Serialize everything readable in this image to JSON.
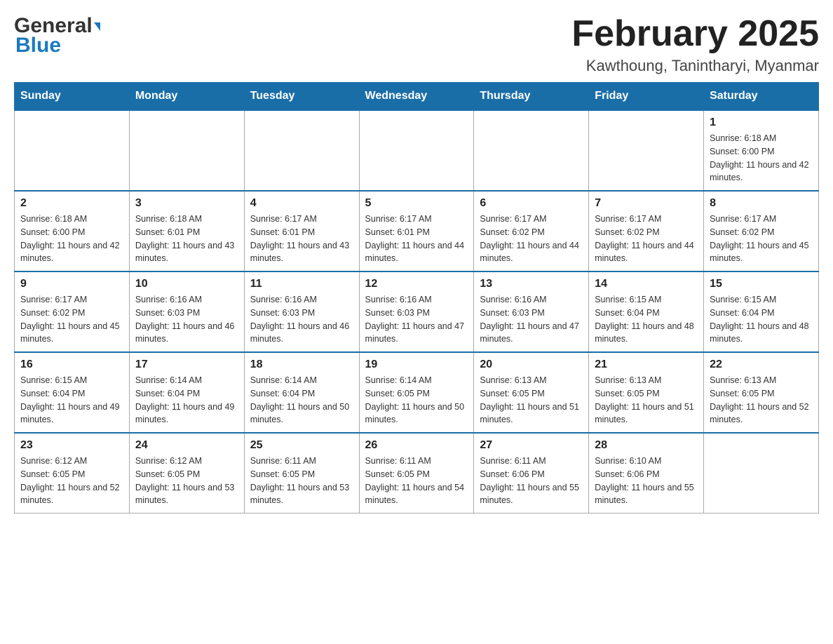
{
  "header": {
    "logo_general": "General",
    "logo_blue": "Blue",
    "month_title": "February 2025",
    "location": "Kawthoung, Tanintharyi, Myanmar"
  },
  "weekdays": [
    "Sunday",
    "Monday",
    "Tuesday",
    "Wednesday",
    "Thursday",
    "Friday",
    "Saturday"
  ],
  "weeks": [
    [
      {
        "day": "",
        "info": ""
      },
      {
        "day": "",
        "info": ""
      },
      {
        "day": "",
        "info": ""
      },
      {
        "day": "",
        "info": ""
      },
      {
        "day": "",
        "info": ""
      },
      {
        "day": "",
        "info": ""
      },
      {
        "day": "1",
        "info": "Sunrise: 6:18 AM\nSunset: 6:00 PM\nDaylight: 11 hours and 42 minutes."
      }
    ],
    [
      {
        "day": "2",
        "info": "Sunrise: 6:18 AM\nSunset: 6:00 PM\nDaylight: 11 hours and 42 minutes."
      },
      {
        "day": "3",
        "info": "Sunrise: 6:18 AM\nSunset: 6:01 PM\nDaylight: 11 hours and 43 minutes."
      },
      {
        "day": "4",
        "info": "Sunrise: 6:17 AM\nSunset: 6:01 PM\nDaylight: 11 hours and 43 minutes."
      },
      {
        "day": "5",
        "info": "Sunrise: 6:17 AM\nSunset: 6:01 PM\nDaylight: 11 hours and 44 minutes."
      },
      {
        "day": "6",
        "info": "Sunrise: 6:17 AM\nSunset: 6:02 PM\nDaylight: 11 hours and 44 minutes."
      },
      {
        "day": "7",
        "info": "Sunrise: 6:17 AM\nSunset: 6:02 PM\nDaylight: 11 hours and 44 minutes."
      },
      {
        "day": "8",
        "info": "Sunrise: 6:17 AM\nSunset: 6:02 PM\nDaylight: 11 hours and 45 minutes."
      }
    ],
    [
      {
        "day": "9",
        "info": "Sunrise: 6:17 AM\nSunset: 6:02 PM\nDaylight: 11 hours and 45 minutes."
      },
      {
        "day": "10",
        "info": "Sunrise: 6:16 AM\nSunset: 6:03 PM\nDaylight: 11 hours and 46 minutes."
      },
      {
        "day": "11",
        "info": "Sunrise: 6:16 AM\nSunset: 6:03 PM\nDaylight: 11 hours and 46 minutes."
      },
      {
        "day": "12",
        "info": "Sunrise: 6:16 AM\nSunset: 6:03 PM\nDaylight: 11 hours and 47 minutes."
      },
      {
        "day": "13",
        "info": "Sunrise: 6:16 AM\nSunset: 6:03 PM\nDaylight: 11 hours and 47 minutes."
      },
      {
        "day": "14",
        "info": "Sunrise: 6:15 AM\nSunset: 6:04 PM\nDaylight: 11 hours and 48 minutes."
      },
      {
        "day": "15",
        "info": "Sunrise: 6:15 AM\nSunset: 6:04 PM\nDaylight: 11 hours and 48 minutes."
      }
    ],
    [
      {
        "day": "16",
        "info": "Sunrise: 6:15 AM\nSunset: 6:04 PM\nDaylight: 11 hours and 49 minutes."
      },
      {
        "day": "17",
        "info": "Sunrise: 6:14 AM\nSunset: 6:04 PM\nDaylight: 11 hours and 49 minutes."
      },
      {
        "day": "18",
        "info": "Sunrise: 6:14 AM\nSunset: 6:04 PM\nDaylight: 11 hours and 50 minutes."
      },
      {
        "day": "19",
        "info": "Sunrise: 6:14 AM\nSunset: 6:05 PM\nDaylight: 11 hours and 50 minutes."
      },
      {
        "day": "20",
        "info": "Sunrise: 6:13 AM\nSunset: 6:05 PM\nDaylight: 11 hours and 51 minutes."
      },
      {
        "day": "21",
        "info": "Sunrise: 6:13 AM\nSunset: 6:05 PM\nDaylight: 11 hours and 51 minutes."
      },
      {
        "day": "22",
        "info": "Sunrise: 6:13 AM\nSunset: 6:05 PM\nDaylight: 11 hours and 52 minutes."
      }
    ],
    [
      {
        "day": "23",
        "info": "Sunrise: 6:12 AM\nSunset: 6:05 PM\nDaylight: 11 hours and 52 minutes."
      },
      {
        "day": "24",
        "info": "Sunrise: 6:12 AM\nSunset: 6:05 PM\nDaylight: 11 hours and 53 minutes."
      },
      {
        "day": "25",
        "info": "Sunrise: 6:11 AM\nSunset: 6:05 PM\nDaylight: 11 hours and 53 minutes."
      },
      {
        "day": "26",
        "info": "Sunrise: 6:11 AM\nSunset: 6:05 PM\nDaylight: 11 hours and 54 minutes."
      },
      {
        "day": "27",
        "info": "Sunrise: 6:11 AM\nSunset: 6:06 PM\nDaylight: 11 hours and 55 minutes."
      },
      {
        "day": "28",
        "info": "Sunrise: 6:10 AM\nSunset: 6:06 PM\nDaylight: 11 hours and 55 minutes."
      },
      {
        "day": "",
        "info": ""
      }
    ]
  ]
}
